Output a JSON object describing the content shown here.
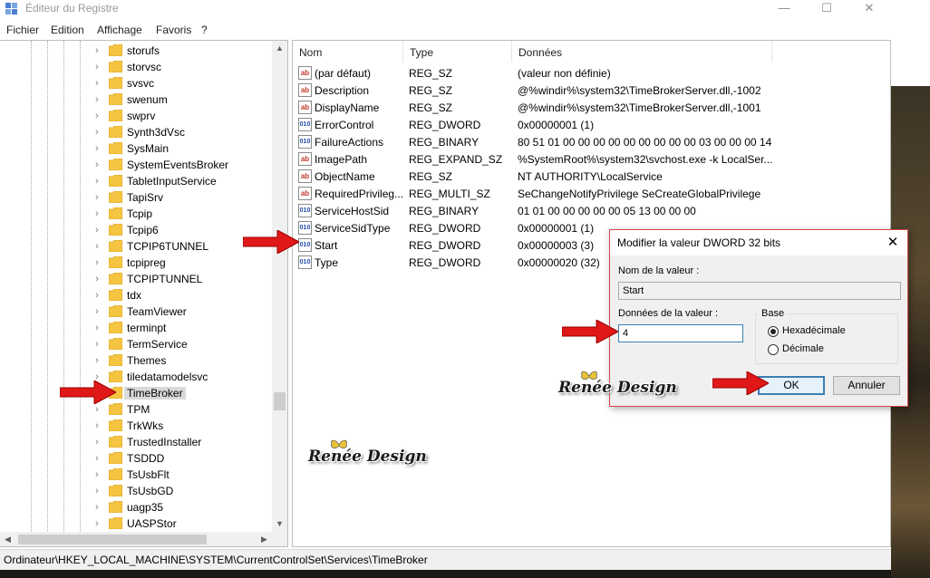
{
  "window": {
    "title": "Éditeur du Registre",
    "controls": {
      "minimize": "—",
      "maximize": "☐",
      "close": "✕"
    }
  },
  "menu": [
    "Fichier",
    "Edition",
    "Affichage",
    "Favoris",
    "?"
  ],
  "tree": {
    "items": [
      "storufs",
      "storvsc",
      "svsvc",
      "swenum",
      "swprv",
      "Synth3dVsc",
      "SysMain",
      "SystemEventsBroker",
      "TabletInputService",
      "TapiSrv",
      "Tcpip",
      "Tcpip6",
      "TCPIP6TUNNEL",
      "tcpipreg",
      "TCPIPTUNNEL",
      "tdx",
      "TeamViewer",
      "terminpt",
      "TermService",
      "Themes",
      "tiledatamodelsvc",
      "TimeBroker",
      "TPM",
      "TrkWks",
      "TrustedInstaller",
      "TSDDD",
      "TsUsbFlt",
      "TsUsbGD",
      "uagp35",
      "UASPStor"
    ],
    "selected_index": 21
  },
  "list": {
    "columns": [
      "Nom",
      "Type",
      "Données"
    ],
    "rows": [
      {
        "name": "(par défaut)",
        "type": "REG_SZ",
        "data": "(valeur non définie)",
        "icon": "string-value-icon"
      },
      {
        "name": "Description",
        "type": "REG_SZ",
        "data": "@%windir%\\system32\\TimeBrokerServer.dll,-1002",
        "icon": "string-value-icon"
      },
      {
        "name": "DisplayName",
        "type": "REG_SZ",
        "data": "@%windir%\\system32\\TimeBrokerServer.dll,-1001",
        "icon": "string-value-icon"
      },
      {
        "name": "ErrorControl",
        "type": "REG_DWORD",
        "data": "0x00000001 (1)",
        "icon": "binary-value-icon"
      },
      {
        "name": "FailureActions",
        "type": "REG_BINARY",
        "data": "80 51 01 00 00 00 00 00 00 00 00 00 03 00 00 00 14 00...",
        "icon": "binary-value-icon"
      },
      {
        "name": "ImagePath",
        "type": "REG_EXPAND_SZ",
        "data": "%SystemRoot%\\system32\\svchost.exe -k LocalSer...",
        "icon": "string-value-icon"
      },
      {
        "name": "ObjectName",
        "type": "REG_SZ",
        "data": "NT AUTHORITY\\LocalService",
        "icon": "string-value-icon"
      },
      {
        "name": "RequiredPrivileg...",
        "type": "REG_MULTI_SZ",
        "data": "SeChangeNotifyPrivilege SeCreateGlobalPrivilege",
        "icon": "string-value-icon"
      },
      {
        "name": "ServiceHostSid",
        "type": "REG_BINARY",
        "data": "01 01 00 00 00 00 00 05 13 00 00 00",
        "icon": "binary-value-icon"
      },
      {
        "name": "ServiceSidType",
        "type": "REG_DWORD",
        "data": "0x00000001 (1)",
        "icon": "binary-value-icon"
      },
      {
        "name": "Start",
        "type": "REG_DWORD",
        "data": "0x00000003 (3)",
        "icon": "binary-value-icon"
      },
      {
        "name": "Type",
        "type": "REG_DWORD",
        "data": "0x00000020 (32)",
        "icon": "binary-value-icon"
      }
    ]
  },
  "status_path": "Ordinateur\\HKEY_LOCAL_MACHINE\\SYSTEM\\CurrentControlSet\\Services\\TimeBroker",
  "dialog": {
    "title": "Modifier la valeur DWORD 32 bits",
    "value_name_label": "Nom de la valeur :",
    "value_name": "Start",
    "value_data_label": "Données de la valeur :",
    "value_data": "4",
    "base_label": "Base",
    "base_hex": "Hexadécimale",
    "base_dec": "Décimale",
    "base_selected": "Hexadécimale",
    "ok": "OK",
    "cancel": "Annuler"
  },
  "watermark": "Renée Design",
  "colors": {
    "arrow": "#e01818",
    "dialog_border": "#d24b4b",
    "focus": "#3c7fb1"
  }
}
